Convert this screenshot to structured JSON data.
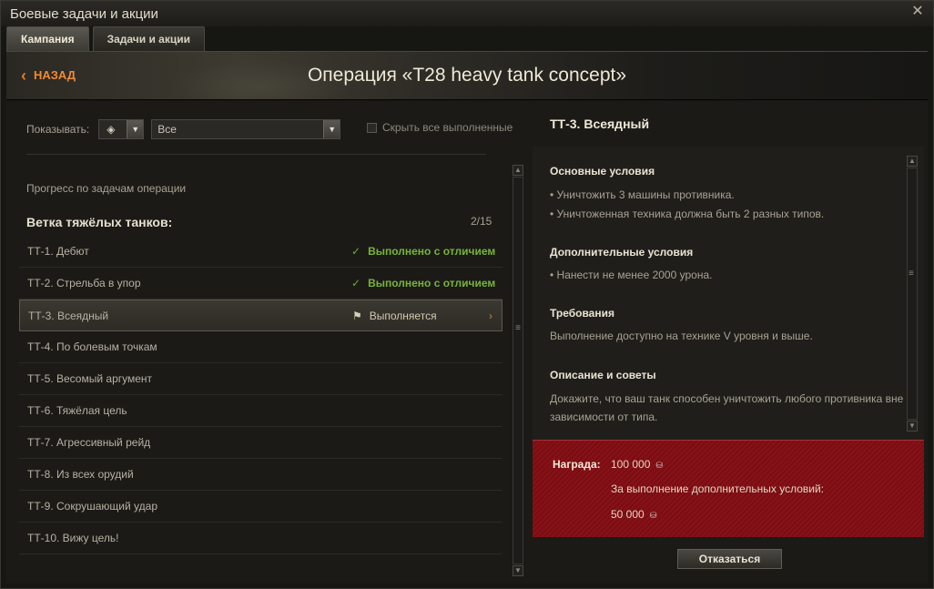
{
  "window": {
    "title": "Боевые задачи и акции"
  },
  "tabs": [
    {
      "label": "Кампания",
      "active": true
    },
    {
      "label": "Задачи и акции",
      "active": false
    }
  ],
  "header": {
    "back_label": "НАЗАД",
    "operation_title": "Операция «T28 heavy tank concept»"
  },
  "filters": {
    "show_label": "Показывать:",
    "type_icon": "vehicle-type-icon",
    "selected": "Все",
    "hide_completed_label": "Скрыть все выполненные",
    "hide_completed_checked": false
  },
  "progress_label": "Прогресс по задачам операции",
  "branch": {
    "title": "Ветка тяжёлых танков:",
    "count": "2/15",
    "tasks": [
      {
        "name": "ТТ-1. Дебют",
        "status": "Выполнено с отличием",
        "state": "done"
      },
      {
        "name": "ТТ-2. Стрельба в упор",
        "status": "Выполнено с отличием",
        "state": "done"
      },
      {
        "name": "ТТ-3. Всеядный",
        "status": "Выполняется",
        "state": "active"
      },
      {
        "name": "ТТ-4. По болевым точкам",
        "status": "",
        "state": "none"
      },
      {
        "name": "ТТ-5. Весомый аргумент",
        "status": "",
        "state": "none"
      },
      {
        "name": "ТТ-6. Тяжёлая цель",
        "status": "",
        "state": "none"
      },
      {
        "name": "ТТ-7. Агрессивный рейд",
        "status": "",
        "state": "none"
      },
      {
        "name": "ТТ-8. Из всех орудий",
        "status": "",
        "state": "none"
      },
      {
        "name": "ТТ-9. Сокрушающий удар",
        "status": "",
        "state": "none"
      },
      {
        "name": "ТТ-10. Вижу цель!",
        "status": "",
        "state": "none"
      }
    ]
  },
  "detail": {
    "title": "ТТ-3. Всеядный",
    "main_conditions_title": "Основные условия",
    "main_conditions": [
      "• Уничтожить 3 машины противника.",
      "• Уничтоженная техника должна быть 2 разных типов."
    ],
    "extra_conditions_title": "Дополнительные условия",
    "extra_conditions": [
      "• Нанести не менее 2000 урона."
    ],
    "requirements_title": "Требования",
    "requirements": "Выполнение доступно на технике V уровня и выше.",
    "tips_title": "Описание и советы",
    "tips_lines": [
      "Докажите, что ваш танк способен уничтожить любого противника вне",
      "зависимости от типа."
    ]
  },
  "reward": {
    "label": "Награда:",
    "credits": "100 000",
    "extra_label": "За выполнение дополнительных условий:",
    "extra_credits": "50 000",
    "currency_icon": "credits-icon"
  },
  "decline_label": "Отказаться",
  "colors": {
    "accent_orange": "#f08a36",
    "done_green": "#78b33b",
    "reward_red": "#7a0e14"
  }
}
